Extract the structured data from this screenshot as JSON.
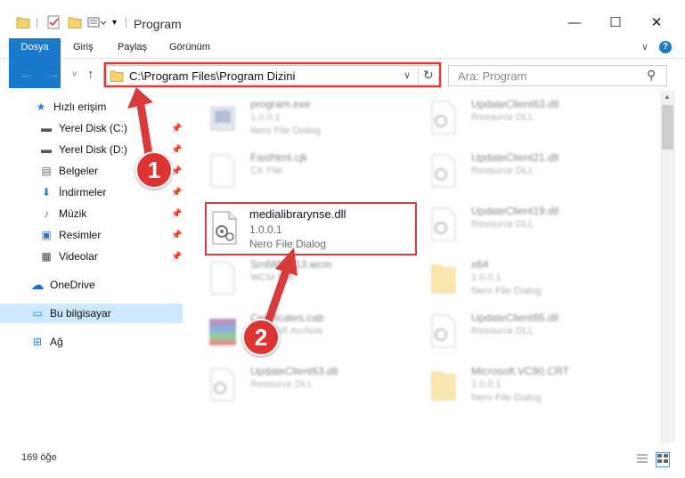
{
  "window": {
    "title": "Program",
    "minimize": "—",
    "maximize": "☐",
    "close": "✕"
  },
  "ribbon": {
    "tabs": [
      "Dosya",
      "Giriş",
      "Paylaş",
      "Görünüm"
    ],
    "expand": "∨",
    "help": "?"
  },
  "nav": {
    "back": "←",
    "forward": "→",
    "recent": "∨",
    "up": "↑",
    "address": "C:\\Program Files\\Program Dizini",
    "dropdown": "∨",
    "refresh": "↻",
    "search_placeholder": "Ara: Program",
    "search_icon": "⚲"
  },
  "sidebar": {
    "items": [
      {
        "label": "Hızlı erişim",
        "icon": "star-icon",
        "glyph": "★",
        "color": "#2b7fd8"
      },
      {
        "label": "Yerel Disk (C:)",
        "icon": "drive-icon",
        "glyph": "▬",
        "color": "#555"
      },
      {
        "label": "Yerel Disk (D:)",
        "icon": "drive-icon",
        "glyph": "▬",
        "color": "#555"
      },
      {
        "label": "Belgeler",
        "icon": "document-icon",
        "glyph": "▤",
        "color": "#667"
      },
      {
        "label": "İndirmeler",
        "icon": "download-icon",
        "glyph": "⬇",
        "color": "#2b7fd8"
      },
      {
        "label": "Müzik",
        "icon": "music-icon",
        "glyph": "♪",
        "color": "#2b7fd8"
      },
      {
        "label": "Resimler",
        "icon": "pictures-icon",
        "glyph": "▣",
        "color": "#3b6fb0"
      },
      {
        "label": "Videolar",
        "icon": "video-icon",
        "glyph": "▦",
        "color": "#444"
      },
      {
        "label": "OneDrive",
        "icon": "cloud-icon",
        "glyph": "☁",
        "color": "#1a6fc4"
      },
      {
        "label": "Bu bilgisayar",
        "icon": "computer-icon",
        "glyph": "▭",
        "color": "#2b7fd8"
      },
      {
        "label": "Ağ",
        "icon": "network-icon",
        "glyph": "⊞",
        "color": "#2b7fd8"
      }
    ],
    "pin": "📌"
  },
  "files": [
    {
      "name": "program.exe",
      "ver": "1.0.0.1",
      "desc": "Nero File Dialog",
      "icon": "exe-icon"
    },
    {
      "name": "UpdateClient63.dll",
      "ver": "",
      "desc": "Resource DLL",
      "icon": "dll-icon"
    },
    {
      "name": "Fasthtml.cjk",
      "ver": "",
      "desc": "CK File",
      "icon": "file-icon"
    },
    {
      "name": "UpdateClient21.dll",
      "ver": "",
      "desc": "Resource DLL",
      "icon": "dll-icon"
    },
    {
      "name": "medialibrarynse.dll",
      "ver": "1.0.0.1",
      "desc": "Nero File Dialog",
      "icon": "dll-icon"
    },
    {
      "name": "UpdateClient19.dll",
      "ver": "",
      "desc": "Resource DLL",
      "icon": "dll-icon"
    },
    {
      "name": "SmlWMP13.wcm",
      "ver": "",
      "desc": "WCM File",
      "icon": "file-icon"
    },
    {
      "name": "x64",
      "ver": "1.0.0.1",
      "desc": "Nero File Dialog",
      "icon": "folder-icon"
    },
    {
      "name": "Certificates.cab",
      "ver": "",
      "desc": "WinRAR Archive",
      "icon": "archive-icon"
    },
    {
      "name": "UpdateClient65.dll",
      "ver": "",
      "desc": "Resource DLL",
      "icon": "dll-icon"
    },
    {
      "name": "UpdateClient63.dll",
      "ver": "",
      "desc": "Resource DLL",
      "icon": "dll-icon"
    },
    {
      "name": "Microsoft.VC90.CRT",
      "ver": "1.0.0.1",
      "desc": "Nero File Dialog",
      "icon": "folder-icon"
    }
  ],
  "status": {
    "count": "169 öğe"
  },
  "annotations": {
    "step1": "1",
    "step2": "2",
    "color": "#d83b3b"
  }
}
